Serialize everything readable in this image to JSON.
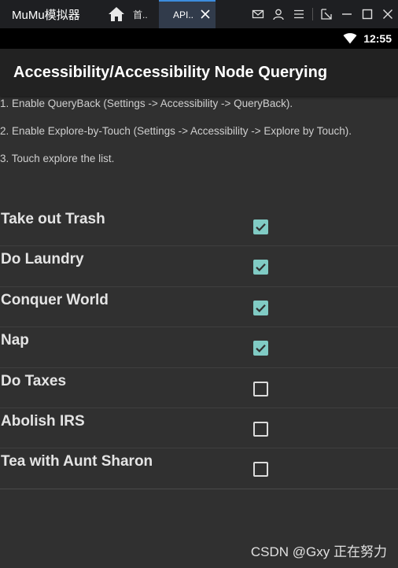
{
  "emulator": {
    "app_name": "MuMu模拟器",
    "home_tab_label": "首..",
    "active_tab_label": "API.."
  },
  "statusbar": {
    "time": "12:55"
  },
  "actionbar": {
    "title": "Accessibility/Accessibility Node Querying"
  },
  "instructions": [
    "1. Enable QueryBack (Settings -> Accessibility -> QueryBack).",
    "2. Enable Explore-by-Touch (Settings -> Accessibility -> Explore by Touch).",
    "3. Touch explore the list."
  ],
  "tasks": [
    {
      "label": "Take out Trash",
      "checked": true
    },
    {
      "label": "Do Laundry",
      "checked": true
    },
    {
      "label": "Conquer World",
      "checked": true
    },
    {
      "label": "Nap",
      "checked": true
    },
    {
      "label": "Do Taxes",
      "checked": false
    },
    {
      "label": "Abolish IRS",
      "checked": false
    },
    {
      "label": "Tea with Aunt Sharon",
      "checked": false
    }
  ],
  "colors": {
    "checkbox_checked": "#80cbc4",
    "tab_accent": "#3c8dde"
  },
  "watermark": "CSDN @Gxy 正在努力"
}
